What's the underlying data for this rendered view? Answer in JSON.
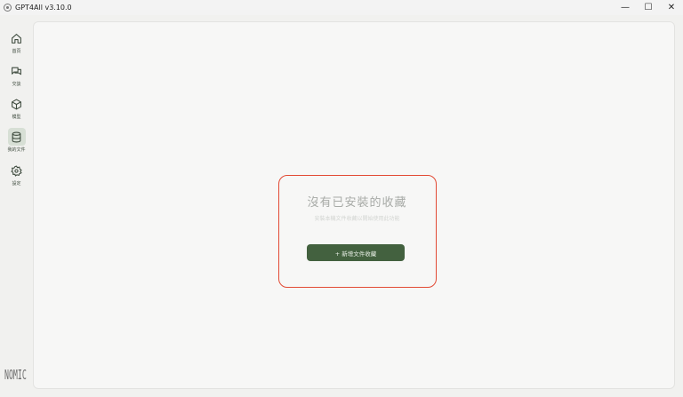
{
  "window": {
    "title": "GPT4All v3.10.0",
    "controls": {
      "minimize": "—",
      "maximize": "☐",
      "close": "✕"
    }
  },
  "sidebar": {
    "items": [
      {
        "label": "首頁",
        "icon": "home-icon",
        "active": false
      },
      {
        "label": "交談",
        "icon": "chat-icon",
        "active": false
      },
      {
        "label": "模型",
        "icon": "cube-icon",
        "active": false
      },
      {
        "label": "我的文件",
        "icon": "database-icon",
        "active": true
      },
      {
        "label": "設定",
        "icon": "gear-icon",
        "active": false
      }
    ],
    "logo": "NOMIC"
  },
  "main": {
    "empty_title": "沒有已安裝的收藏",
    "empty_subtitle": "安裝本機文件收藏以開始使用此功能",
    "add_button_label": "+ 新增文件收藏"
  },
  "colors": {
    "accent": "#43613f",
    "highlight_border": "#e24a34",
    "active_nav_bg": "#d7dfd5"
  }
}
